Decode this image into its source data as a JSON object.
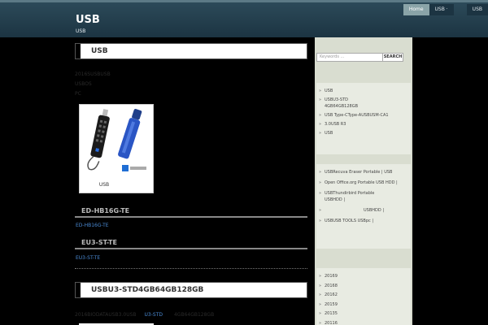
{
  "header": {
    "title": "USB",
    "description": "USB",
    "nav": [
      {
        "label": "Home",
        "active": true
      },
      {
        "label": "USB ·",
        "active": false
      },
      {
        "label": "USB",
        "active": false
      }
    ]
  },
  "main": {
    "post1_title": "USB",
    "post1_lines": [
      "2016SUSBUSB",
      "USBOS",
      "PC"
    ],
    "figure_caption": "USB",
    "section1_heading": "ED-HB16G-TE",
    "section1_link": "ED-HB16G-TE",
    "section2_heading": "EU3-ST-TE",
    "section2_link": "EU3-ST-TE",
    "post2_title": "USBU3-STD4GB64GB128GB",
    "post2_meta_left": "2016BIODATAUSB3.0USB",
    "post2_meta_link": "U3-STD",
    "post2_meta_right": "4GB64GB128GB"
  },
  "sidebar": {
    "search_placeholder": "Keywords ...",
    "search_button": "SEARCH",
    "list1": [
      "USB",
      "USBU3-STD 4GB64GB128GB",
      "USB Type-CType-AUSBUSM-CA1",
      "3.0USB R3",
      "USB"
    ],
    "list2": [
      "USBRecuva Eraser Portable | USB",
      "Open Office.org Portable USB HDD |",
      "USBThundirbird Portable USBHDD |",
      "USBHDD |",
      "USBUSB TOOLS USBpc |"
    ],
    "list3": [
      "20169",
      "20168",
      "20162",
      "20159",
      "20135",
      "20116"
    ]
  }
}
